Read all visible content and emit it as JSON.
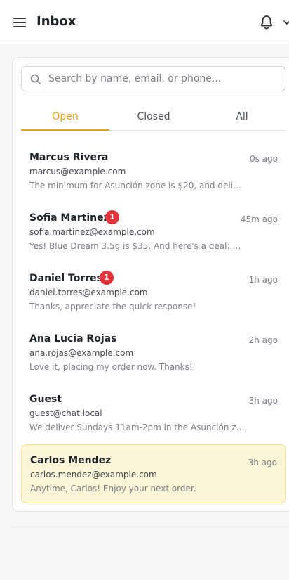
{
  "header": {
    "title": "Inbox",
    "menu_icon": "hamburger-icon",
    "notification_icon": "bell-icon",
    "dropdown_icon": "chevron-down-icon"
  },
  "search": {
    "placeholder": "Search by name, email, or phone...",
    "value": "",
    "icon": "search-icon"
  },
  "tabs": [
    {
      "label": "Open",
      "active": true
    },
    {
      "label": "Closed",
      "active": false
    },
    {
      "label": "All",
      "active": false
    }
  ],
  "conversations": [
    {
      "name": "Marcus Rivera",
      "email": "marcus@example.com",
      "time": "0s ago",
      "preview": "The minimum for Asunción zone is $20, and delivery...",
      "unread": null,
      "selected": false
    },
    {
      "name": "Sofia Martinez",
      "email": "sofia.martinez@example.com",
      "time": "45m ago",
      "preview": "Yes! Blue Dream 3.5g is $35. And here's a deal: bu...",
      "unread": "1",
      "selected": false
    },
    {
      "name": "Daniel Torres",
      "email": "daniel.torres@example.com",
      "time": "1h ago",
      "preview": "Thanks, appreciate the quick response!",
      "unread": "1",
      "selected": false
    },
    {
      "name": "Ana Lucia Rojas",
      "email": "ana.rojas@example.com",
      "time": "2h ago",
      "preview": "Love it, placing my order now. Thanks!",
      "unread": null,
      "selected": false
    },
    {
      "name": "Guest",
      "email": "guest@chat.local",
      "time": "3h ago",
      "preview": "We deliver Sundays 11am-2pm in the Asunción zone!...",
      "unread": null,
      "selected": false
    },
    {
      "name": "Carlos Mendez",
      "email": "carlos.mendez@example.com",
      "time": "3h ago",
      "preview": "Anytime, Carlos! Enjoy your next order.",
      "unread": null,
      "selected": true
    }
  ],
  "colors": {
    "accent": "#e8a31a",
    "badge": "#e5333b",
    "selected_bg": "#fdf6d6"
  }
}
